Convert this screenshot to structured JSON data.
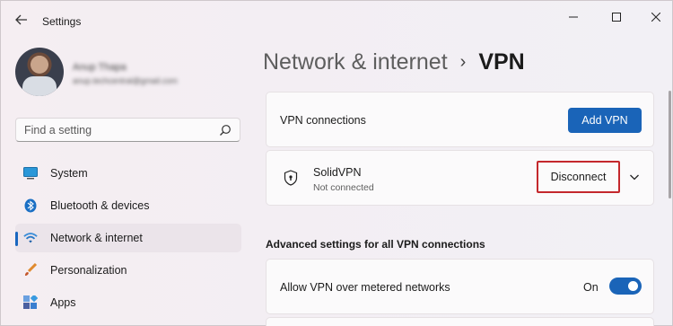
{
  "window": {
    "title": "Settings",
    "controls": {
      "minimize": "minimize-icon",
      "maximize": "maximize-icon",
      "close": "close-icon"
    }
  },
  "profile": {
    "name": "Anup Thapa",
    "email": "anup.techcentral@gmail.com"
  },
  "search": {
    "placeholder": "Find a setting",
    "value": ""
  },
  "sidebar": {
    "items": [
      {
        "label": "System",
        "icon": "monitor-icon",
        "active": false
      },
      {
        "label": "Bluetooth & devices",
        "icon": "bluetooth-icon",
        "active": false
      },
      {
        "label": "Network & internet",
        "icon": "wifi-icon",
        "active": true
      },
      {
        "label": "Personalization",
        "icon": "brush-icon",
        "active": false
      },
      {
        "label": "Apps",
        "icon": "apps-icon",
        "active": false
      }
    ]
  },
  "breadcrumb": {
    "parent": "Network & internet",
    "separator": "›",
    "current": "VPN"
  },
  "vpn_connections": {
    "label": "VPN connections",
    "add_button": "Add VPN"
  },
  "vpn_entry": {
    "name": "SolidVPN",
    "status": "Not connected",
    "disconnect_button": "Disconnect"
  },
  "advanced": {
    "title": "Advanced settings for all VPN connections",
    "metered": {
      "label": "Allow VPN over metered networks",
      "state": "On",
      "on": true
    }
  },
  "colors": {
    "accent": "#1a64b8",
    "highlight_border": "#c4282c"
  }
}
